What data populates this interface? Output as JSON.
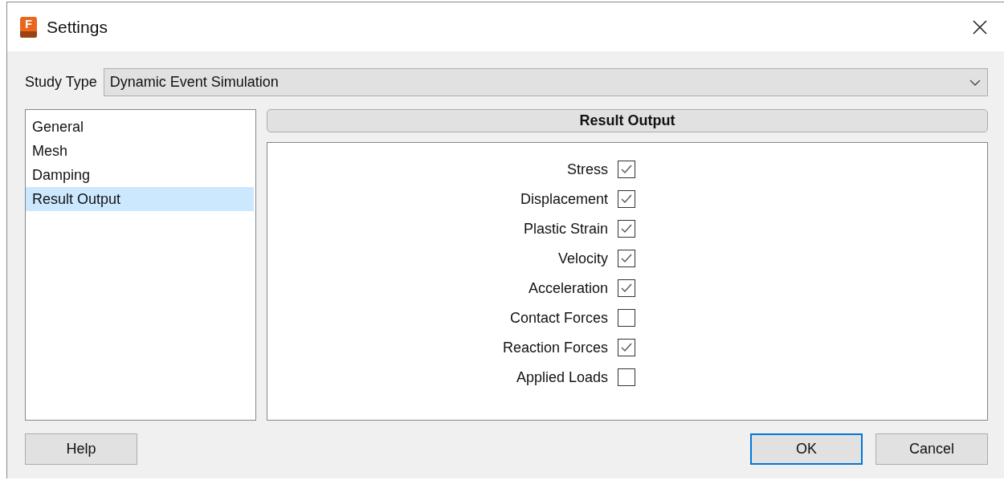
{
  "window": {
    "title": "Settings",
    "app_icon_letter": "F"
  },
  "study_type": {
    "label": "Study Type",
    "value": "Dynamic Event Simulation"
  },
  "sidebar": {
    "items": [
      {
        "label": "General",
        "selected": false
      },
      {
        "label": "Mesh",
        "selected": false
      },
      {
        "label": "Damping",
        "selected": false
      },
      {
        "label": "Result Output",
        "selected": true
      }
    ]
  },
  "panel": {
    "title": "Result Output",
    "options": [
      {
        "label": "Stress",
        "checked": true
      },
      {
        "label": "Displacement",
        "checked": true
      },
      {
        "label": "Plastic Strain",
        "checked": true
      },
      {
        "label": "Velocity",
        "checked": true
      },
      {
        "label": "Acceleration",
        "checked": true
      },
      {
        "label": "Contact Forces",
        "checked": false
      },
      {
        "label": "Reaction Forces",
        "checked": true
      },
      {
        "label": "Applied Loads",
        "checked": false
      }
    ]
  },
  "buttons": {
    "help": "Help",
    "ok": "OK",
    "cancel": "Cancel"
  }
}
